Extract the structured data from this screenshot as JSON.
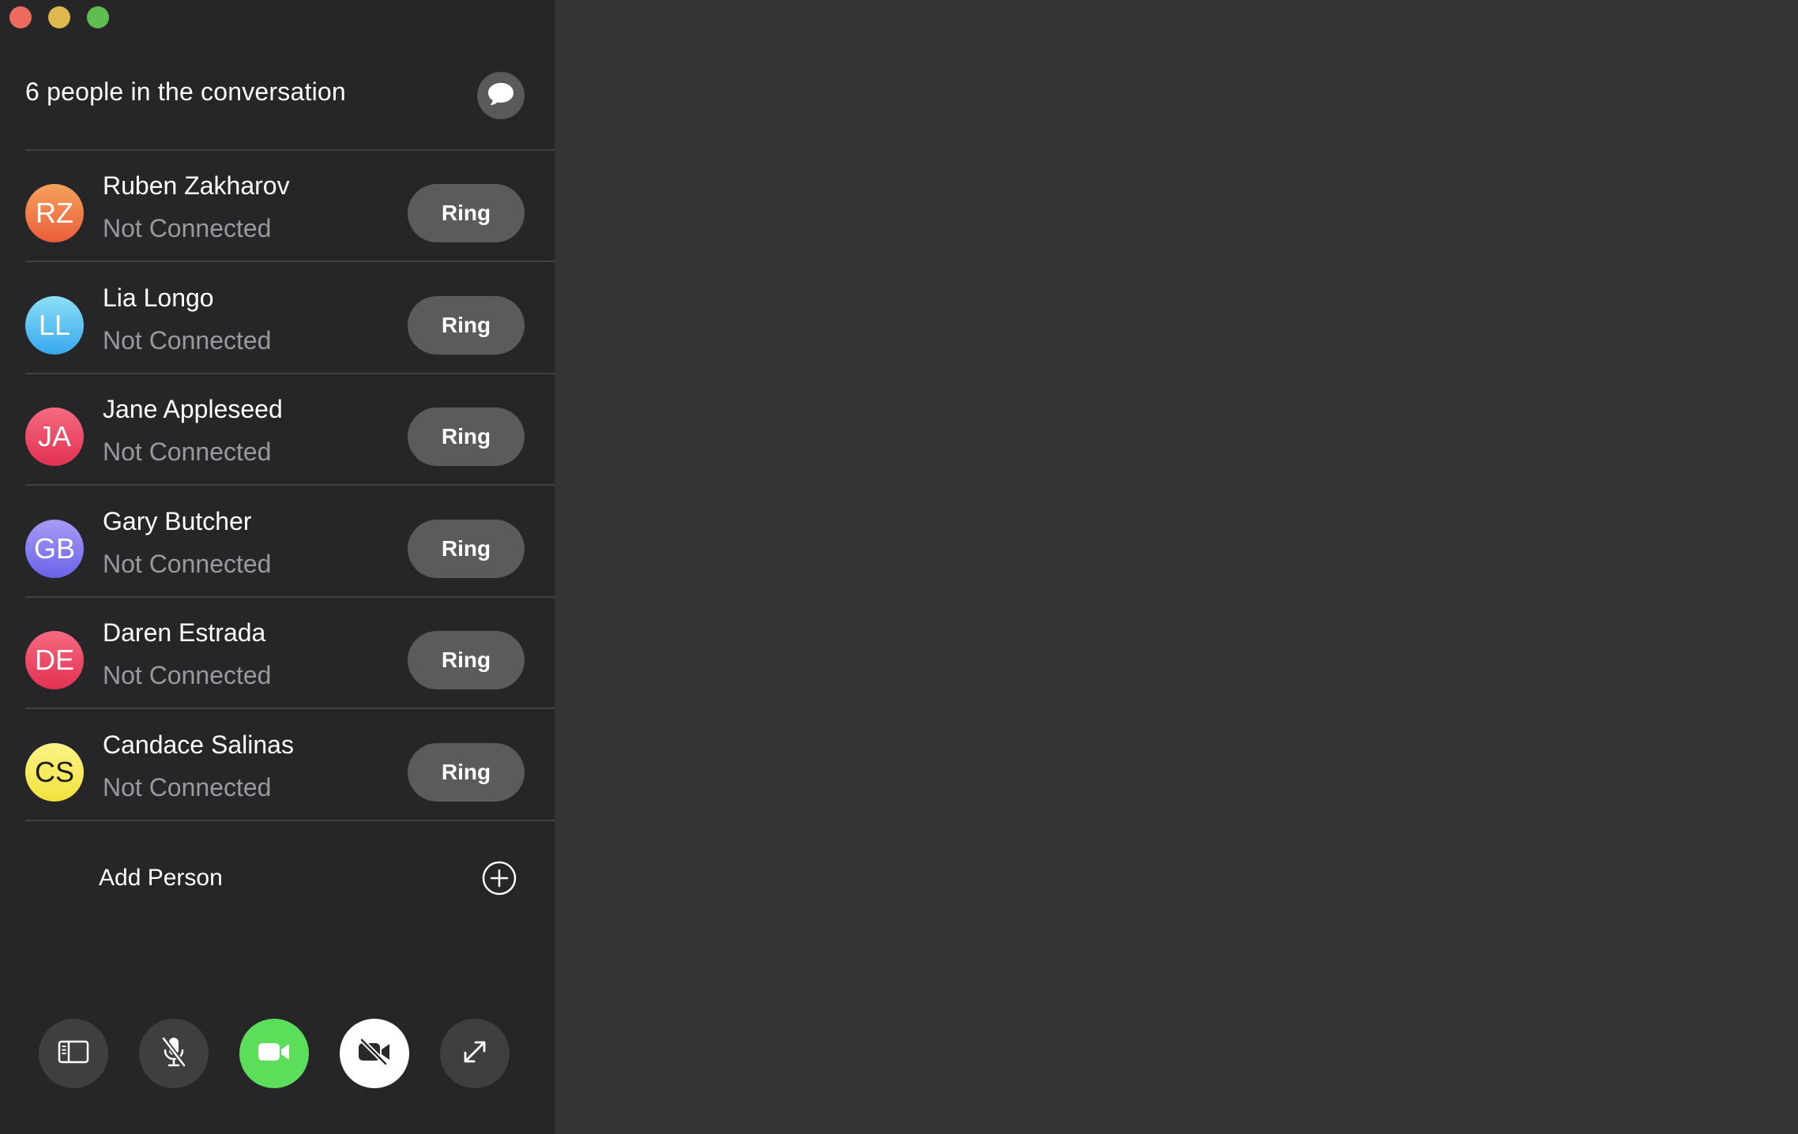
{
  "window": {
    "controls": [
      "close",
      "minimize",
      "zoom"
    ]
  },
  "header": {
    "title": "6 people in the conversation",
    "chat_icon": "speech-bubble-icon"
  },
  "participants": [
    {
      "initials": "RZ",
      "name": "Ruben Zakharov",
      "status": "Not Connected",
      "action": "Ring",
      "avatar_color_top": "#f5a25c",
      "avatar_color_bottom": "#ea5d3a",
      "initials_color": "#ffffff"
    },
    {
      "initials": "LL",
      "name": "Lia Longo",
      "status": "Not Connected",
      "action": "Ring",
      "avatar_color_top": "#8bdff7",
      "avatar_color_bottom": "#36a8ec",
      "initials_color": "#ffffff"
    },
    {
      "initials": "JA",
      "name": "Jane Appleseed",
      "status": "Not Connected",
      "action": "Ring",
      "avatar_color_top": "#f56a7f",
      "avatar_color_bottom": "#e33152",
      "initials_color": "#ffffff"
    },
    {
      "initials": "GB",
      "name": "Gary Butcher",
      "status": "Not Connected",
      "action": "Ring",
      "avatar_color_top": "#a79bf7",
      "avatar_color_bottom": "#6a63e8",
      "initials_color": "#ffffff"
    },
    {
      "initials": "DE",
      "name": "Daren Estrada",
      "status": "Not Connected",
      "action": "Ring",
      "avatar_color_top": "#f56a7f",
      "avatar_color_bottom": "#e33152",
      "initials_color": "#ffffff"
    },
    {
      "initials": "CS",
      "name": "Candace Salinas",
      "status": "Not Connected",
      "action": "Ring",
      "avatar_color_top": "#fbf28a",
      "avatar_color_bottom": "#f1e23a",
      "initials_color": "#1c1c1e"
    }
  ],
  "add_person": {
    "label": "Add Person",
    "icon": "plus-circle-icon"
  },
  "controls": [
    {
      "name": "sidebar-toggle-button",
      "icon": "sidebar-icon",
      "style": "dark"
    },
    {
      "name": "mute-button",
      "icon": "microphone-slash-icon",
      "style": "dark"
    },
    {
      "name": "video-button",
      "icon": "video-camera-icon",
      "style": "green"
    },
    {
      "name": "camera-off-button",
      "icon": "video-camera-slash-icon",
      "style": "white"
    },
    {
      "name": "fullscreen-button",
      "icon": "expand-arrows-icon",
      "style": "dark"
    }
  ],
  "colors": {
    "sidebar_bg": "#262628",
    "main_bg": "#343434",
    "ring_button_bg": "#5b5b5e",
    "accent_green": "#5cde5a",
    "status_text": "#9a9a9e"
  }
}
